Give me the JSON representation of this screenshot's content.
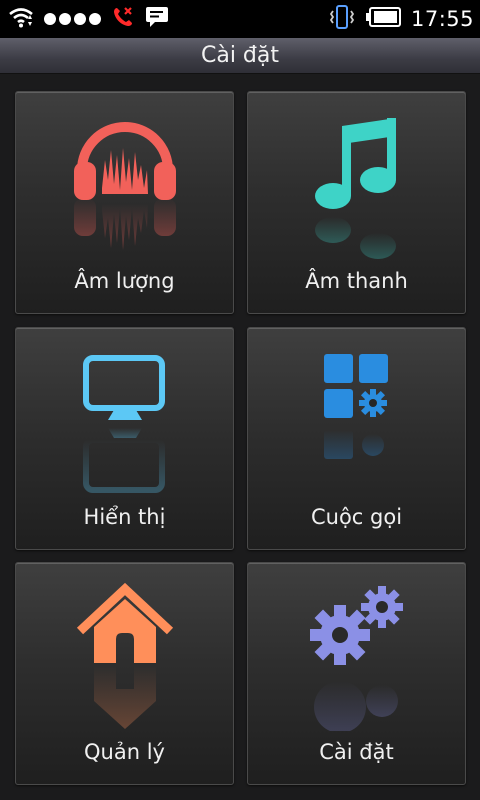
{
  "status_bar": {
    "time": "17:55",
    "icons": [
      "wifi-icon",
      "signal-dots",
      "missed-call-icon",
      "message-icon",
      "vibrate-icon",
      "battery-icon"
    ]
  },
  "header": {
    "title": "Cài đặt"
  },
  "tiles": [
    {
      "label": "Âm lượng",
      "icon": "headphones-icon",
      "color": "#f2615a"
    },
    {
      "label": "Âm thanh",
      "icon": "music-note-icon",
      "color": "#3ed3c7"
    },
    {
      "label": "Hiển thị",
      "icon": "monitor-icon",
      "color": "#5cc8f5"
    },
    {
      "label": "Cuộc gọi",
      "icon": "apps-gear-icon",
      "color": "#2a8de0"
    },
    {
      "label": "Quản lý",
      "icon": "home-icon",
      "color": "#ff8f5a"
    },
    {
      "label": "Cài đặt",
      "icon": "gears-icon",
      "color": "#8b90e6"
    }
  ]
}
